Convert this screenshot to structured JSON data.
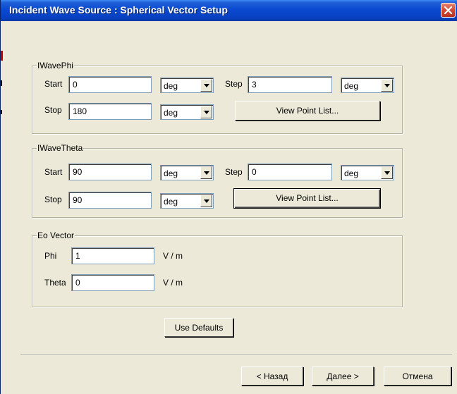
{
  "window": {
    "title": "Incident Wave Source : Spherical Vector Setup"
  },
  "groups": {
    "phi": {
      "legend": "IWavePhi",
      "start_label": "Start",
      "start_value": "0",
      "start_unit": "deg",
      "step_label": "Step",
      "step_value": "3",
      "step_unit": "deg",
      "stop_label": "Stop",
      "stop_value": "180",
      "stop_unit": "deg",
      "view_button": "View Point List..."
    },
    "theta": {
      "legend": "IWaveTheta",
      "start_label": "Start",
      "start_value": "90",
      "start_unit": "deg",
      "step_label": "Step",
      "step_value": "0",
      "step_unit": "deg",
      "stop_label": "Stop",
      "stop_value": "90",
      "stop_unit": "deg",
      "view_button": "View Point List..."
    },
    "eo": {
      "legend": "Eo Vector",
      "phi_label": "Phi",
      "phi_value": "1",
      "phi_unit": "V / m",
      "theta_label": "Theta",
      "theta_value": "0",
      "theta_unit": "V / m"
    }
  },
  "buttons": {
    "use_defaults": "Use Defaults",
    "back": "< Назад",
    "next": "Далее >",
    "cancel": "Отмена"
  },
  "colors": {
    "title_bar": "#0a49d0",
    "dialog_face": "#ece9d8",
    "close_button": "#d34a32"
  }
}
